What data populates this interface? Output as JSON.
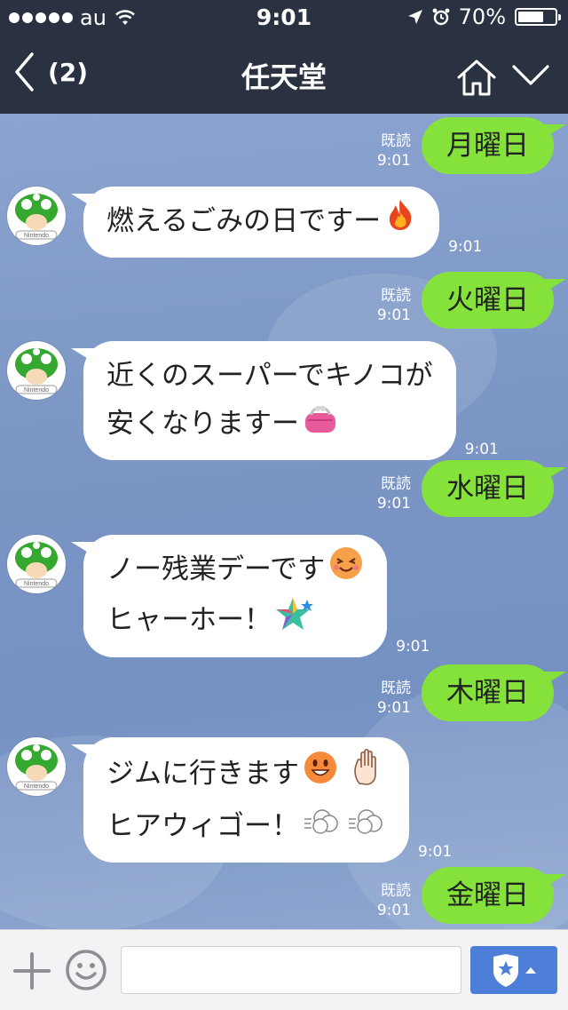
{
  "status_bar": {
    "carrier": "au",
    "time": "9:01",
    "battery": "70%",
    "battery_level": 0.7
  },
  "nav": {
    "back_count": "(2)",
    "title": "任天堂"
  },
  "messages": [
    {
      "side": "right",
      "read": "既読",
      "time": "9:01",
      "text": "月曜日"
    },
    {
      "side": "left",
      "lines": [
        "燃えるごみの日ですー"
      ],
      "emojis": [
        "fire-emoji"
      ],
      "time": "9:01"
    },
    {
      "side": "right",
      "read": "既読",
      "time": "9:01",
      "text": "火曜日"
    },
    {
      "side": "left",
      "lines": [
        "近くのスーパーでキノコが",
        "安くなりますー"
      ],
      "emojis": [
        "purse-emoji"
      ],
      "time": "9:01"
    },
    {
      "side": "right",
      "read": "既読",
      "time": "9:01",
      "text": "水曜日"
    },
    {
      "side": "left",
      "lines": [
        "ノー残業デーです",
        "ヒャーホー！"
      ],
      "emojis": [
        "happy-face-emoji",
        "star-emoji"
      ],
      "time": "9:01"
    },
    {
      "side": "right",
      "read": "既読",
      "time": "9:01",
      "text": "木曜日"
    },
    {
      "side": "left",
      "lines": [
        "ジムに行きます",
        "ヒアウィゴー！"
      ],
      "emojis": [
        "grin-face-emoji",
        "raised-hand-emoji",
        "dash-emoji",
        "dash-emoji"
      ],
      "time": "9:01"
    },
    {
      "side": "right",
      "read": "既読",
      "time": "9:01",
      "text": "金曜日"
    }
  ],
  "avatar": {
    "label": "Nintendo"
  },
  "input": {
    "placeholder": ""
  },
  "colors": {
    "navbar": "#2a3242",
    "sent_bubble": "#84e23a",
    "received_bubble": "#ffffff",
    "sticker_button": "#4d7fd8"
  }
}
